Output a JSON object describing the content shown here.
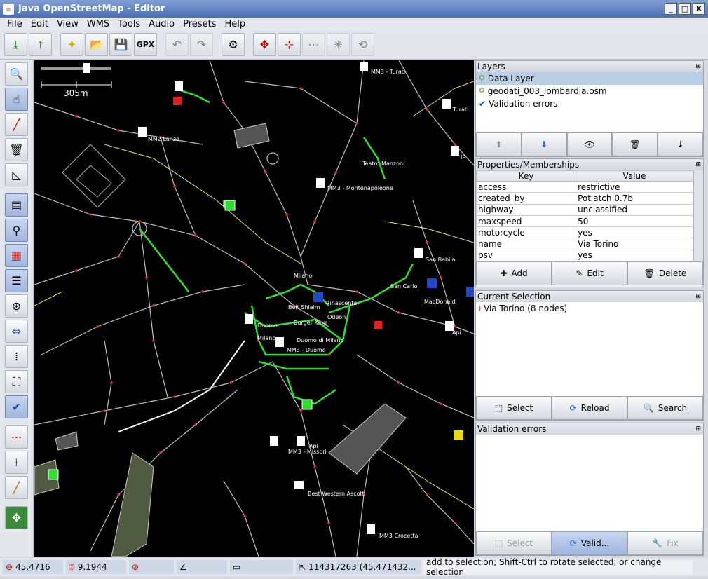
{
  "window": {
    "title": "Java OpenStreetMap - Editor",
    "min": "_",
    "max": "□",
    "close": "X"
  },
  "menu": [
    "File",
    "Edit",
    "View",
    "WMS",
    "Tools",
    "Audio",
    "Presets",
    "Help"
  ],
  "toolbar": {
    "gpx": "GPX"
  },
  "map": {
    "scale": "305m",
    "labels": [
      "MM3 - Turati",
      "Turati",
      "MM2 Lanza",
      "Teatro Manzoni",
      "MM3 - Montenapoleone",
      "IP",
      "San Babila",
      "San Carlo",
      "MacDonald",
      "Milano",
      "Rinascente",
      "Beit Shlaim",
      "Burger King",
      "Odeon",
      "Duomo",
      "Duomo di Milano",
      "MM3 - Duomo",
      "Milano",
      "Api",
      "MM3 - Missori",
      "Best Western Ascott",
      "MM3 Crocetta",
      "Api"
    ]
  },
  "layers": {
    "title": "Layers",
    "items": [
      "Data Layer",
      "geodati_003_lombardia.osm",
      "Validation errors"
    ]
  },
  "properties": {
    "title": "Properties/Memberships",
    "col_key": "Key",
    "col_value": "Value",
    "rows": [
      {
        "k": "access",
        "v": "restrictive"
      },
      {
        "k": "created_by",
        "v": "Potlatch 0.7b"
      },
      {
        "k": "highway",
        "v": "unclassified"
      },
      {
        "k": "maxspeed",
        "v": "50"
      },
      {
        "k": "motorcycle",
        "v": "yes"
      },
      {
        "k": "name",
        "v": "Via Torino"
      },
      {
        "k": "psv",
        "v": "yes"
      }
    ],
    "add": "Add",
    "edit": "Edit",
    "delete": "Delete"
  },
  "selection": {
    "title": "Current Selection",
    "item": "Via Torino (8 nodes)",
    "select": "Select",
    "reload": "Reload",
    "search": "Search"
  },
  "validation": {
    "title": "Validation errors",
    "select": "Select",
    "valid": "Valid...",
    "fix": "Fix"
  },
  "status": {
    "lat": "45.4716",
    "lon": "9.1944",
    "way": "114317263 (45.471432...",
    "help": "add to selection; Shift-Ctrl to rotate selected; or change selection"
  }
}
